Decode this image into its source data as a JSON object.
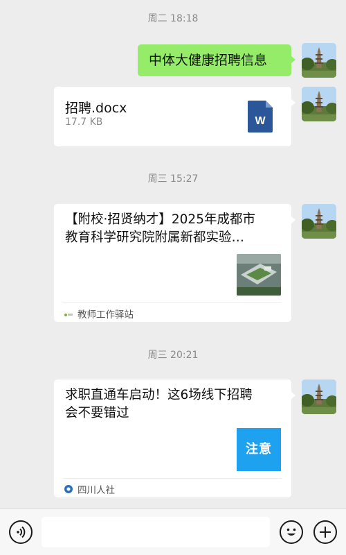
{
  "messages": {
    "time1": "周二 18:18",
    "text1": "中体大健康招聘信息",
    "file": {
      "name": "招聘.docx",
      "size": "17.7 KB",
      "icon_label": "W"
    },
    "time2": "周三 15:27",
    "article1": {
      "title_line1": "【附校·招贤纳才】2025年成都市",
      "title_line2": "教育科学研究院附属新都实验…",
      "source": "教师工作驿站"
    },
    "time3": "周三 20:21",
    "article2": {
      "title_line1": "求职直通车启动！这6场线下招聘",
      "title_line2": "会不要错过",
      "thumb_text": "注意",
      "source": "四川人社"
    }
  },
  "colors": {
    "background": "#ededed",
    "sent_bubble": "#95ec69",
    "card": "#ffffff",
    "word_icon": "#2b579a"
  },
  "icons": [
    "voice-icon",
    "emoji-icon",
    "plus-icon",
    "word-file-icon"
  ]
}
